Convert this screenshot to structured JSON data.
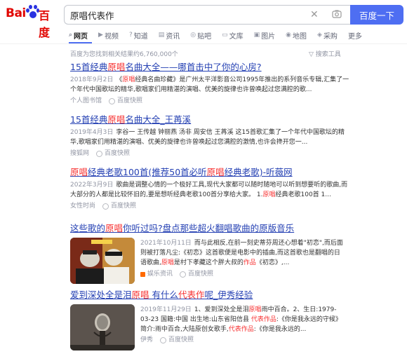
{
  "logo": {
    "left": "Bai",
    "right": "百度"
  },
  "search": {
    "query": "原唱代表作",
    "button": "百度一下"
  },
  "tabs": [
    {
      "icon": "⌕",
      "label": "网页"
    },
    {
      "icon": "▶",
      "label": "视频"
    },
    {
      "icon": "?",
      "label": "知道"
    },
    {
      "icon": "▤",
      "label": "资讯"
    },
    {
      "icon": "◎",
      "label": "贴吧"
    },
    {
      "icon": "▭",
      "label": "文库"
    },
    {
      "icon": "▣",
      "label": "图片"
    },
    {
      "icon": "◉",
      "label": "地图"
    },
    {
      "icon": "◈",
      "label": "采购"
    },
    {
      "icon": "",
      "label": "更多"
    }
  ],
  "result_count": "百度为您找到相关结果约6,760,000个",
  "tools_label": "搜索工具",
  "results": [
    {
      "title_pre": "15首经典",
      "title_hl": "原唱",
      "title_post": "名曲大全——哪首击中了你的心房?",
      "date": "2018年9月2日",
      "desc_a": "《",
      "desc_hl": "原唱",
      "desc_b": "经典名曲珍藏》是广州太平洋影音公司1995年推出的系列音乐专辑,汇集了一个年代中国歌坛的精华,歌唱家们用精湛的演唱、优美的旋律也许曾唤起过您满腔的歌...",
      "source": "个人图书馆",
      "snapshot": "百度快照"
    },
    {
      "title_pre": "15首经典",
      "title_hl": "原唱",
      "title_post": "名曲大全_王苒溪",
      "date": "2019年4月3日",
      "desc": "李谷一 王传越 钟丽燕 汤非 周安信 王苒溪 这15首歌汇集了一个年代中国歌坛的精华,歌唱家们用精湛的演唱、优美的旋律也许曾唤起过您满腔的激情,也许会搀开您一...",
      "source": "搜狐网",
      "snapshot": "百度快照"
    },
    {
      "title_hl1": "原唱",
      "title_mid1": "经典老歌100首(推荐50首必听",
      "title_hl2": "原唱",
      "title_mid2": "经典老歌)-听薇网",
      "date": "2022年3月9日",
      "desc_a": "歌曲是调整心情的一个极好工具,现代大家都可以随时随地可以听到想要听的歌曲,而大部分的人都是比较怀旧的,要是想听经典老歌100首分享给大家。 1.",
      "desc_hl": "原唱",
      "desc_b": "经典老歌100首 1...",
      "source": "女性时尚",
      "snapshot": "百度快照"
    },
    {
      "title_pre": "这些歌的",
      "title_hl": "原唱",
      "title_post": "你听过吗?盘点那些超火翻唱歌曲的原版音乐",
      "date": "2021年10月11日",
      "desc_a": "而与此相反,在前一刻史蒂芬周还心想着\"初恋\",而后面则被打落凡尘:《初恋》这首歌便是电影中的插曲,而这首歌也是翻唱的日语歌曲,",
      "desc_hl1": "原唱",
      "desc_b": "是村下孝藏这个胖大叔的",
      "desc_hl2": "作品",
      "desc_c": "《初恋》,...",
      "source": "娱乐资讯",
      "snapshot": "百度快照"
    },
    {
      "title_pre": "爱到深处全是泪",
      "title_hl": "原唱",
      "title_mid": " 有什么",
      "title_hl2": "代表作",
      "title_post": "呢_伊秀经验",
      "date": "2019年11月29日",
      "desc_a": "1、爱到深处全是泪",
      "desc_hl1": "原唱",
      "desc_b": "雨中百合。2、生日:1979-03-23 国籍:中国 出生地:山东省阳信县 ",
      "desc_hl2": "代表作品",
      "desc_c": ":《你是我永远的守候》简介:雨中百合,大陆原创女歌手,",
      "desc_hl3": "代表作品",
      "desc_d": ":《你是我永远的...",
      "source": "伊秀",
      "snapshot": "百度快照"
    }
  ]
}
